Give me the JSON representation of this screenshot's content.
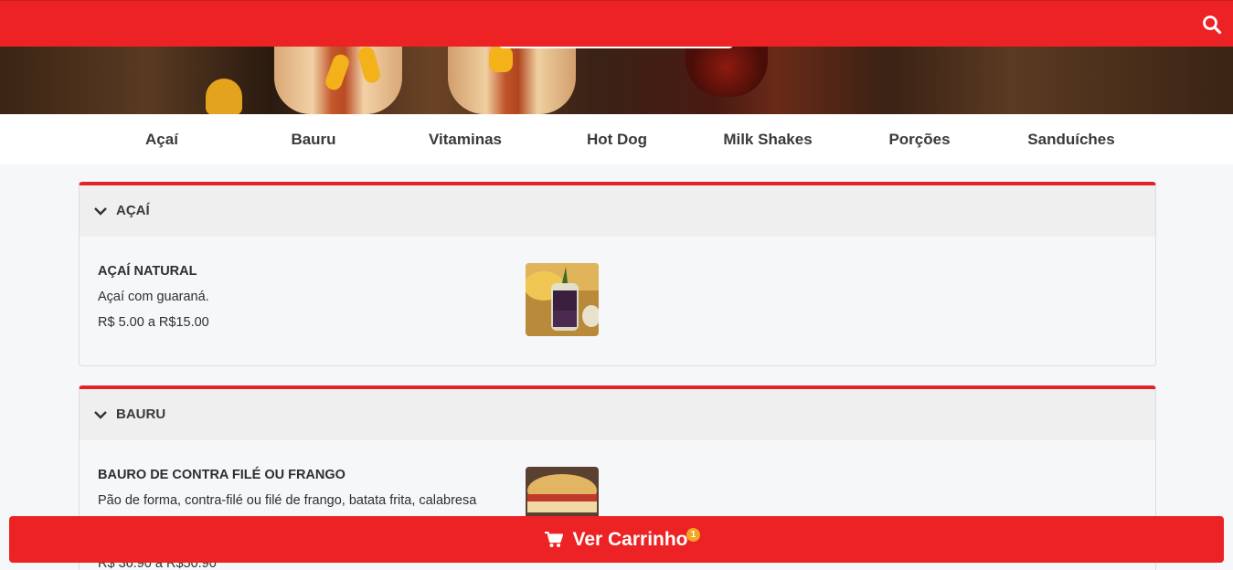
{
  "header": {
    "search_icon": "search-icon"
  },
  "categories": [
    "Açaí",
    "Bauru",
    "Vitaminas",
    "Hot Dog",
    "Milk Shakes",
    "Porções",
    "Sanduíches"
  ],
  "sections": [
    {
      "title": "AÇAÍ",
      "items": [
        {
          "name": "AÇAÍ NATURAL",
          "description": "Açaí com guaraná.",
          "price": "R$ 5.00 a R$15.00"
        }
      ]
    },
    {
      "title": "BAURU",
      "items": [
        {
          "name": "BAURO DE CONTRA FILÉ OU FRANGO",
          "description": "Pão de forma, contra-filé ou filé de frango, batata frita, calabresa",
          "price": "R$ 36.90 a R$50.90"
        }
      ]
    }
  ],
  "cart": {
    "label": "Ver Carrinho",
    "count": "1",
    "icon": "cart-icon"
  },
  "colors": {
    "brand": "#ed2224",
    "badge": "#f5a623"
  }
}
